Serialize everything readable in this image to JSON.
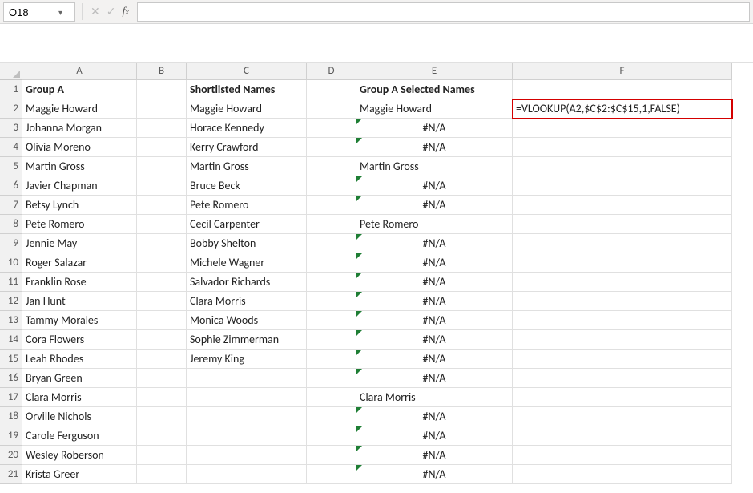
{
  "namebox": {
    "value": "O18"
  },
  "formula_bar": {
    "value": ""
  },
  "highlight_formula": "=VLOOKUP(A2,$C$2:$C$15,1,FALSE)",
  "columns": [
    "A",
    "B",
    "C",
    "D",
    "E",
    "F"
  ],
  "row_numbers": [
    1,
    2,
    3,
    4,
    5,
    6,
    7,
    8,
    9,
    10,
    11,
    12,
    13,
    14,
    15,
    16,
    17,
    18,
    19,
    20,
    21
  ],
  "headers": {
    "A": "Group A",
    "C": "Shortlisted Names",
    "E": "Group A Selected Names"
  },
  "colA": [
    "Maggie Howard",
    "Johanna Morgan",
    "Olivia Moreno",
    "Martin Gross",
    "Javier Chapman",
    "Betsy Lynch",
    "Pete Romero",
    "Jennie May",
    "Roger Salazar",
    "Franklin Rose",
    "Jan Hunt",
    "Tammy Morales",
    "Cora Flowers",
    "Leah Rhodes",
    "Bryan Green",
    "Clara Morris",
    "Orville Nichols",
    "Carole Ferguson",
    "Wesley Roberson",
    "Krista Greer"
  ],
  "colC": [
    "Maggie Howard",
    "Horace Kennedy",
    "Kerry Crawford",
    "Martin Gross",
    "Bruce Beck",
    "Pete Romero",
    "Cecil Carpenter",
    "Bobby Shelton",
    "Michele Wagner",
    "Salvador Richards",
    "Clara Morris",
    "Monica Woods",
    "Sophie Zimmerman",
    "Jeremy King",
    "",
    "",
    "",
    "",
    "",
    ""
  ],
  "colE": [
    {
      "v": "Maggie Howard",
      "na": false
    },
    {
      "v": "#N/A",
      "na": true
    },
    {
      "v": "#N/A",
      "na": true
    },
    {
      "v": "Martin Gross",
      "na": false
    },
    {
      "v": "#N/A",
      "na": true
    },
    {
      "v": "#N/A",
      "na": true
    },
    {
      "v": "Pete Romero",
      "na": false
    },
    {
      "v": "#N/A",
      "na": true
    },
    {
      "v": "#N/A",
      "na": true
    },
    {
      "v": "#N/A",
      "na": true
    },
    {
      "v": "#N/A",
      "na": true
    },
    {
      "v": "#N/A",
      "na": true
    },
    {
      "v": "#N/A",
      "na": true
    },
    {
      "v": "#N/A",
      "na": true
    },
    {
      "v": "#N/A",
      "na": true
    },
    {
      "v": "Clara Morris",
      "na": false
    },
    {
      "v": "#N/A",
      "na": true
    },
    {
      "v": "#N/A",
      "na": true
    },
    {
      "v": "#N/A",
      "na": true
    },
    {
      "v": "#N/A",
      "na": true
    }
  ]
}
